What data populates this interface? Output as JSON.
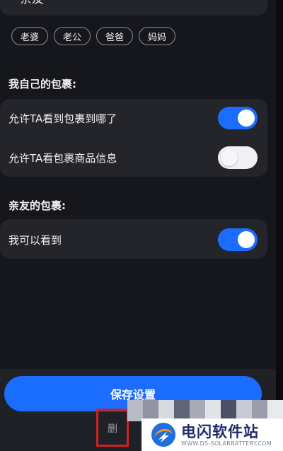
{
  "relation": {
    "value": "亲友"
  },
  "quick_tags": [
    "老婆",
    "老公",
    "爸爸",
    "妈妈"
  ],
  "my_parcels": {
    "title": "我自己的包裹:",
    "items": [
      {
        "label": "允许TA看到包裹到哪了",
        "enabled": true
      },
      {
        "label": "允许TA看包裹商品信息",
        "enabled": false
      }
    ]
  },
  "friend_parcels": {
    "title": "亲友的包裹:",
    "items": [
      {
        "label": "我可以看到",
        "enabled": true
      }
    ]
  },
  "actions": {
    "save_label": "保存设置",
    "delete_label": "删"
  },
  "watermark": {
    "title": "电闪软件站",
    "subtitle": "WWW.DS-SOLARBATTERY.COM"
  },
  "colors": {
    "background": "#16171c",
    "card": "#24252b",
    "accent": "#1a6dff",
    "highlight_box": "#d02020"
  }
}
